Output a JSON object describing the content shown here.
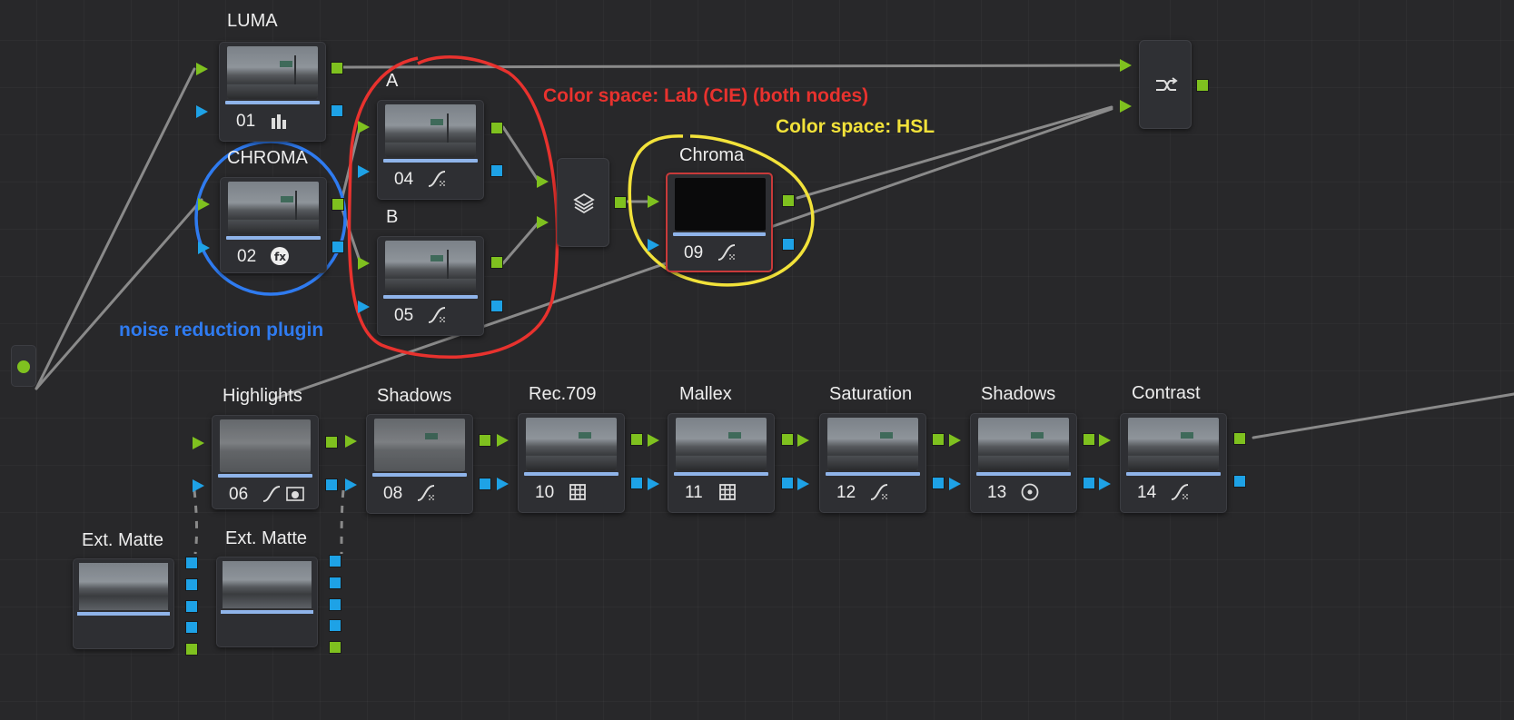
{
  "nodes": {
    "n01": {
      "title": "LUMA",
      "number": "01",
      "tool": "bars-icon"
    },
    "n02": {
      "title": "CHROMA",
      "number": "02",
      "tool": "fx-icon"
    },
    "n04": {
      "title": "A",
      "number": "04",
      "tool": "curve-icon"
    },
    "n05": {
      "title": "B",
      "number": "05",
      "tool": "curve-icon"
    },
    "n09": {
      "title": "Chroma",
      "number": "09",
      "tool": "curve-icon"
    },
    "n06": {
      "title": "Highlights",
      "number": "06",
      "tool": "curve-icon",
      "tool2": "qualifier-icon"
    },
    "n08": {
      "title": "Shadows",
      "number": "08",
      "tool": "curve-icon"
    },
    "n10": {
      "title": "Rec.709",
      "number": "10",
      "tool": "grid-icon"
    },
    "n11": {
      "title": "Mallex",
      "number": "11",
      "tool": "grid-icon"
    },
    "n12": {
      "title": "Saturation",
      "number": "12",
      "tool": "curve-icon"
    },
    "n13": {
      "title": "Shadows",
      "number": "13",
      "tool": "window-circle-icon"
    },
    "n14": {
      "title": "Contrast",
      "number": "14",
      "tool": "curve-icon"
    }
  },
  "mattes": {
    "m1": {
      "title": "Ext. Matte"
    },
    "m2": {
      "title": "Ext. Matte"
    }
  },
  "annotations": {
    "lab": {
      "text": "Color space: Lab (CIE) (both nodes)",
      "color": "#e8322e"
    },
    "hsl": {
      "text": "Color space: HSL",
      "color": "#f2e23a"
    },
    "noise": {
      "text": "noise reduction plugin",
      "color": "#2f7bf0"
    }
  },
  "colors": {
    "rgb_port": "#7fc11f",
    "alpha_port": "#1ea2e6",
    "selected_border": "#c93a3a",
    "thumb_bar": "#8fb4ea"
  },
  "mixers": {
    "layer": {
      "icon": "layers-icon"
    },
    "splitter": {
      "icon": "splitter-combiner-icon"
    }
  }
}
